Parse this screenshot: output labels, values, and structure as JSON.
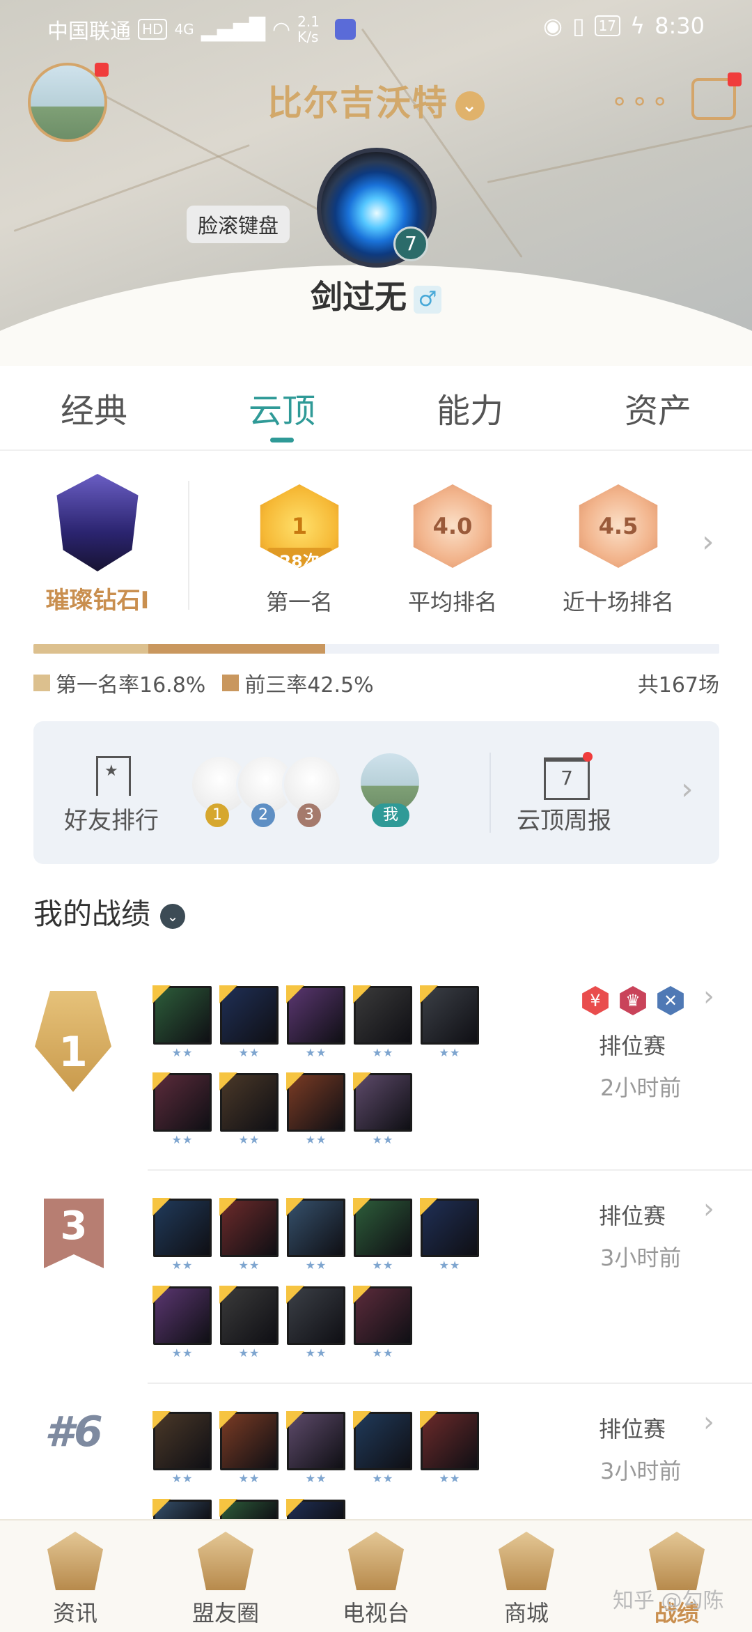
{
  "status_bar": {
    "carrier": "中国联通",
    "hd": "HD",
    "net": "4G",
    "speed": "2.1 K/s",
    "battery": "17",
    "time": "8:30"
  },
  "header": {
    "title": "比尔吉沃特",
    "title_icon": "chevron-down-icon",
    "tag": "脸滚键盘",
    "rank_level": "7",
    "player_name": "剑过无",
    "gender": "♂"
  },
  "tabs": [
    {
      "label": "经典",
      "active": false
    },
    {
      "label": "云顶",
      "active": true
    },
    {
      "label": "能力",
      "active": false
    },
    {
      "label": "资产",
      "active": false
    }
  ],
  "summary": {
    "tier_name": "璀璨钻石I",
    "medals": [
      {
        "value": "1",
        "sub": "28次",
        "label": "第一名"
      },
      {
        "value": "4.0",
        "label": "平均排名"
      },
      {
        "value": "4.5",
        "label": "近十场排名"
      }
    ],
    "first_rate_value": 16.8,
    "top3_rate_value": 42.5,
    "first_rate_text": "第一名率16.8%",
    "top3_rate_text": "前三率42.5%",
    "total": "共167场",
    "colors": {
      "first": "#dcc08e",
      "top3": "#c9975e",
      "accent": "#2f9a97"
    }
  },
  "friends": {
    "label": "好友排行",
    "ranks": [
      "1",
      "2",
      "3"
    ],
    "me": "我",
    "weekly_label": "云顶周报",
    "weekly_day": "7"
  },
  "records": {
    "title": "我的战绩",
    "matches": [
      {
        "place": "1",
        "mode": "排位赛",
        "time": "2小时前",
        "traits": [
          "¥",
          "♛",
          "✕"
        ]
      },
      {
        "place": "3",
        "mode": "排位赛",
        "time": "3小时前"
      },
      {
        "place": "#6",
        "mode": "排位赛",
        "time": "3小时前"
      }
    ]
  },
  "bottom_nav": [
    {
      "label": "资讯",
      "active": false
    },
    {
      "label": "盟友圈",
      "active": false
    },
    {
      "label": "电视台",
      "active": false
    },
    {
      "label": "商城",
      "active": false
    },
    {
      "label": "战绩",
      "active": true
    }
  ],
  "watermark": "知乎 @勾陈"
}
